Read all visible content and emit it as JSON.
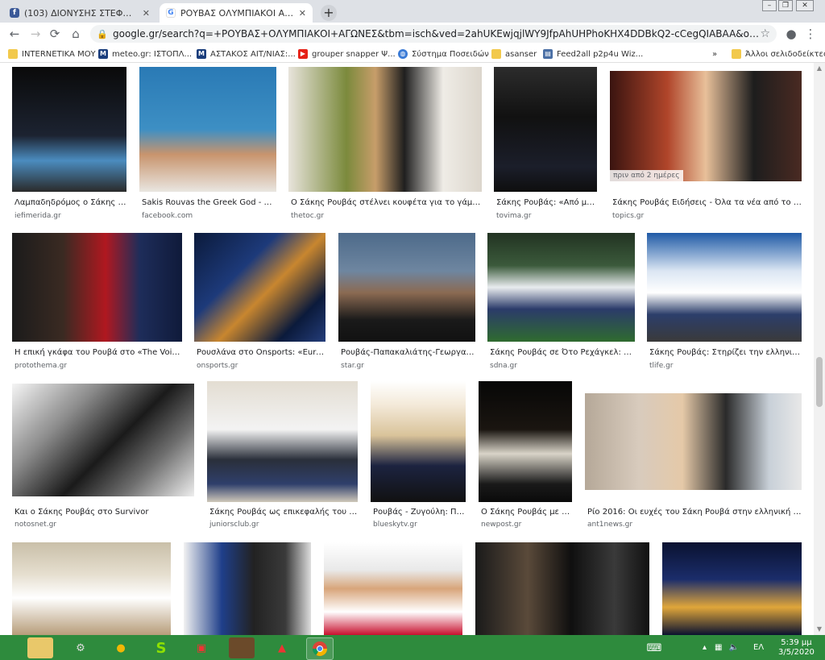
{
  "browser": {
    "tabs": [
      {
        "title": "(103) ΔΙΟΝΥΣΗΣ ΣΤΕΦΑΝΙΔΑΚΗΣ",
        "favicon": "facebook-icon",
        "active": false
      },
      {
        "title": "ΡΟΥΒΑΣ ΟΛΥΜΠΙΑΚΟΙ ΑΓΩΝΕΣ",
        "favicon": "google-icon",
        "active": true
      }
    ],
    "url": "google.gr/search?q=+ΡΟΥΒΑΣ+ΟΛΥΜΠΙΑΚΟΙ+ΑΓΩΝΕΣ&tbm=isch&ved=2ahUKEwjqjlWY9JfpAhUHPhoKHX4DDBkQ2-cCegQIABAA&oq=+ΡΟΥΒΑΣ+ΟΛΥΜΠΙ..."
  },
  "bookmarks": [
    {
      "label": "INTERNETIKA ΜΟΥ",
      "icon": "folder-icon"
    },
    {
      "label": "meteo.gr: ΙΣΤΟΠΛ...",
      "icon": "meteo-icon"
    },
    {
      "label": "ΑΣΤΑΚΟΣ ΑΙΤ/ΝΙΑΣ:...",
      "icon": "news-icon"
    },
    {
      "label": "grouper snapper Ψ...",
      "icon": "youtube-icon"
    },
    {
      "label": "Σύστημα Ποσειδών",
      "icon": "globe-icon"
    },
    {
      "label": "asanser",
      "icon": "folder-icon"
    },
    {
      "label": "Feed2all p2p4u Wiz...",
      "icon": "page-icon"
    },
    {
      "label": "»",
      "icon": "overflow-icon"
    },
    {
      "label": "Άλλοι σελιδοδείκτες",
      "icon": "folder-icon"
    }
  ],
  "results": [
    {
      "caption": "Λαμπαδηδρόμος ο Σάκης Ρο...",
      "source": "iefimerida.gr"
    },
    {
      "caption": "Sakis Rouvas the Greek God - Post...",
      "source": "facebook.com"
    },
    {
      "caption": "Ο Σάκης Ρουβάς στέλνει κουφέτα για το γάμο του...",
      "source": "thetoc.gr"
    },
    {
      "caption": "Σάκης Ρουβάς: «Από μικρ...",
      "source": "tovima.gr"
    },
    {
      "caption": "Σάκης Ρουβάς Ειδήσεις - Όλα τα νέα από το topic...",
      "source": "topics.gr",
      "badge": "πριν από 2 ημέρες"
    },
    {
      "caption": "Η επική γκάφα του Ρουβά στο «The Voice»",
      "source": "protothema.gr"
    },
    {
      "caption": "Ρουσλάνα στο Onsports: «Eurovis...",
      "source": "onsports.gr"
    },
    {
      "caption": "Ρουβάς-Παπακαλιάτης-Γεωργαντά...",
      "source": "star.gr"
    },
    {
      "caption": "Σάκης Ρουβάς σε Ότο Ρεχάγκελ: Τι κ...",
      "source": "sdna.gr"
    },
    {
      "caption": "Σάκης Ρουβάς: Στηρίζει την ελληνική ο...",
      "source": "tlife.gr"
    },
    {
      "caption": "Και ο Σάκης Ρουβάς στο Survivor",
      "source": "notosnet.gr"
    },
    {
      "caption": "Σάκης Ρουβάς ως επικεφαλής του πρ...",
      "source": "juniorsclub.gr"
    },
    {
      "caption": "Ρουβάς - Ζυγούλη: Πήρ...",
      "source": "blueskytv.gr"
    },
    {
      "caption": "Ο Σάκης Ρουβάς με τη...",
      "source": "newpost.gr"
    },
    {
      "caption": "Ρίο 2016: Οι ευχές του Σάκη Ρουβά στην ελληνική αποσ...",
      "source": "ant1news.gr"
    },
    {
      "caption": "",
      "source": ""
    },
    {
      "caption": "",
      "source": ""
    },
    {
      "caption": "",
      "source": ""
    },
    {
      "caption": "",
      "source": ""
    },
    {
      "caption": "",
      "source": ""
    }
  ],
  "taskbar": {
    "language": "ΕΛ",
    "time": "5:39 μμ",
    "date": "3/5/2020"
  },
  "colors": {
    "taskbar": "#2e8b3d",
    "tabstrip": "#dee1e6",
    "link_source": "#5f6368"
  }
}
